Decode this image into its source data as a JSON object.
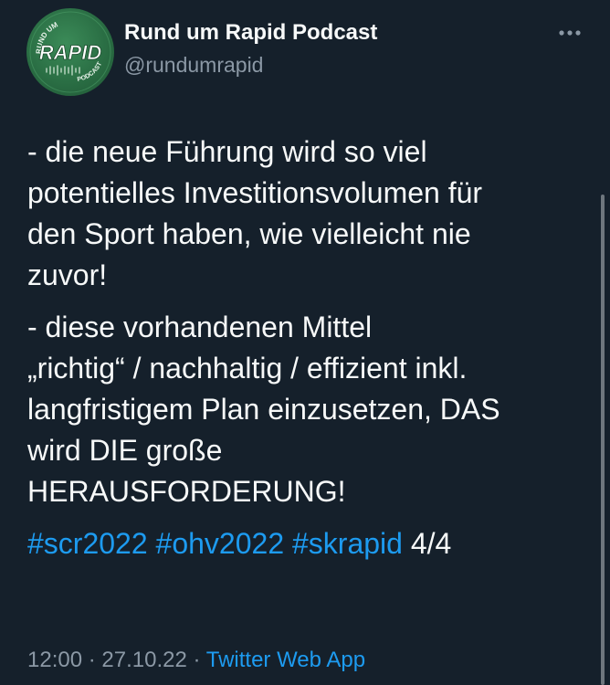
{
  "author": {
    "name": "Rund um Rapid Podcast",
    "handle": "@rundumrapid",
    "avatar": {
      "logo_text": "RAPID",
      "arc_top_text": "RUND UM",
      "arc_bottom_text": "PODCAST",
      "bg_color": "#2a6e44"
    }
  },
  "more_icon": "ellipsis-icon",
  "tweet": {
    "paragraphs": [
      "- die neue Führung wird so viel\npotentielles Investitionsvolumen für\nden Sport haben, wie vielleicht nie\nzuvor!",
      "- diese vorhandenen Mittel\n„richtig“ / nachhaltig / effizient inkl.\nlangfristigem Plan einzusetzen, DAS\nwird DIE große\nHERAUSFORDERUNG!"
    ],
    "hashtags": [
      "#scr2022",
      "#ohv2022",
      "#skrapid"
    ],
    "thread_count": "4/4"
  },
  "meta": {
    "time": "12:00",
    "separator": "·",
    "date": "27.10.22",
    "source": "Twitter Web App"
  },
  "colors": {
    "background": "#15202b",
    "text": "#f7f9f9",
    "secondary": "#8b98a5",
    "link": "#1d9bf0"
  }
}
